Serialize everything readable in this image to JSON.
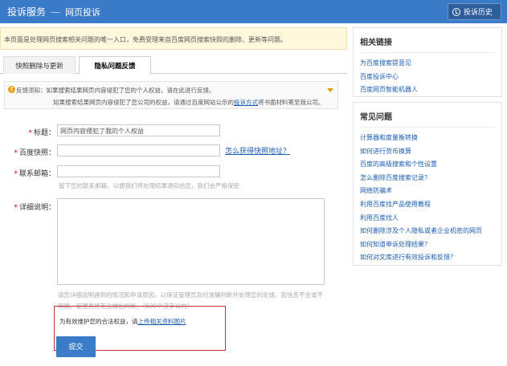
{
  "header": {
    "title": "投诉服务",
    "separator": "—",
    "subtitle": "网页投诉",
    "history_button": "投诉历史"
  },
  "notice": "本页面是处理网页搜索相关问题的唯一入口，免费受理来自百度网页搜索快照的删除、更新等问题。",
  "tabs": [
    {
      "label": "快照删除与更新"
    },
    {
      "label": "隐私问题反馈"
    }
  ],
  "tip": {
    "line1": "反馈须知：如果搜索结果网页内容侵犯了您的个人权益，请在此进行反馈。",
    "line2_prefix": "如果搜索结果网页内容侵犯了您公司的权益，请通过百度网站公示的",
    "line2_link": "投诉方式",
    "line2_suffix": "将书面材料寄至我公司。"
  },
  "form": {
    "title_label": "标题：",
    "title_value": "网页内容侵犯了我的个人权益",
    "snapshot_label": "百度快照：",
    "snapshot_help": "怎么获得快照地址？",
    "email_label": "联系邮箱：",
    "email_hint": "留下您的联系邮箱，以便我们将处理结果通知给您，我们会严格保密",
    "detail_label": "详细说明：",
    "detail_hint_1": "请您详细说明遇到的情况和申请原因，以保证管理员及时准确判断并处理您的反馈。若信息不全或不",
    "detail_hint_2": "明确，管理员将无法做出判断。（500个汉字以内）",
    "upload_prefix": "为有效维护您的合法权益，请",
    "upload_link": "上传相关资料图片",
    "submit_label": "提交"
  },
  "sidebar": {
    "related_title": "相关链接",
    "related_links": [
      "为百度搜索提意见",
      "百度投诉中心",
      "百度网页智能机器人"
    ],
    "faq_title": "常见问题",
    "faq_links": [
      "计算器和度量衡转换",
      "如何进行货币换算",
      "百度的高级搜索和个性设置",
      "怎么删除百度搜索记录？",
      "网络防骗术",
      "利用百度找产品使用教程",
      "利用百度找人",
      "如何删除涉及个人隐私或者企业机密的网页",
      "如何知道申诉处理结果？",
      "如何对文库进行有效投诉和反馈？"
    ]
  },
  "colors": {
    "header_bg": "#3a7bc8",
    "link": "#1a5db3",
    "required": "#dd0000",
    "highlight_border": "#c53030"
  }
}
